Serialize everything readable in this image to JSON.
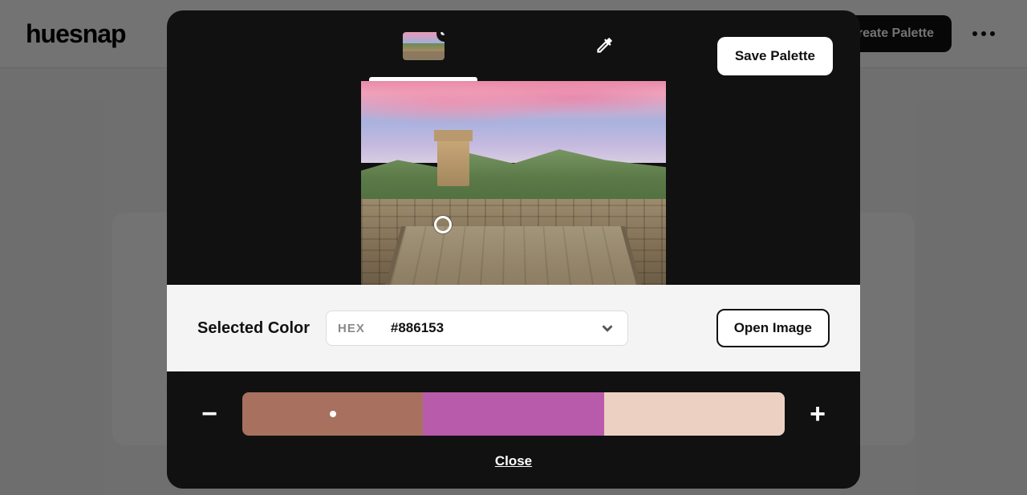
{
  "header": {
    "logo": "huesnap",
    "create_palette": "Create Palette"
  },
  "modal": {
    "save_palette": "Save Palette",
    "selected_color_label": "Selected Color",
    "color_format": "HEX",
    "color_value": "#886153",
    "open_image": "Open Image",
    "close": "Close",
    "palette": [
      {
        "hex": "#a8715f",
        "active": true
      },
      {
        "hex": "#b95bab",
        "active": false
      },
      {
        "hex": "#ecd0c1",
        "active": false
      }
    ]
  }
}
